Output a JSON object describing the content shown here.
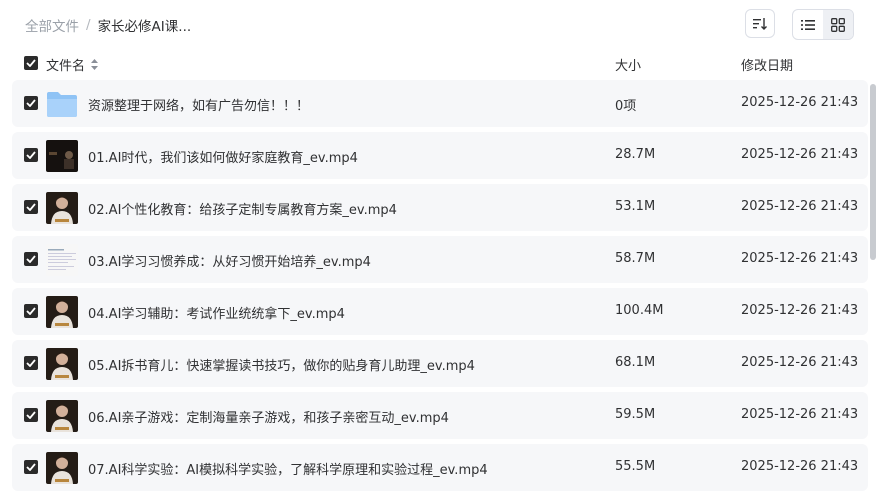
{
  "breadcrumb": {
    "root": "全部文件",
    "separator": "/",
    "current": "家长必修AI课..."
  },
  "toolbar": {
    "sort_icon": "sort-lines-icon",
    "list_icon": "list-view-icon",
    "grid_icon": "grid-view-icon"
  },
  "columns": {
    "name": "文件名",
    "size": "大小",
    "date": "修改日期"
  },
  "files": [
    {
      "name": "资源整理于网络，如有广告勿信！！！",
      "size": "0项",
      "date": "2025-12-26 21:43",
      "kind": "folder"
    },
    {
      "name": "01.AI时代，我们该如何做好家庭教育_ev.mp4",
      "size": "28.7M",
      "date": "2025-12-26 21:43",
      "kind": "video-dark"
    },
    {
      "name": "02.AI个性化教育：给孩子定制专属教育方案_ev.mp4",
      "size": "53.1M",
      "date": "2025-12-26 21:43",
      "kind": "video-person"
    },
    {
      "name": "03.AI学习习惯养成：从好习惯开始培养_ev.mp4",
      "size": "58.7M",
      "date": "2025-12-26 21:43",
      "kind": "video-doc"
    },
    {
      "name": "04.AI学习辅助：考试作业统统拿下_ev.mp4",
      "size": "100.4M",
      "date": "2025-12-26 21:43",
      "kind": "video-person"
    },
    {
      "name": "05.AI拆书育儿：快速掌握读书技巧，做你的贴身育儿助理_ev.mp4",
      "size": "68.1M",
      "date": "2025-12-26 21:43",
      "kind": "video-person"
    },
    {
      "name": "06.AI亲子游戏：定制海量亲子游戏，和孩子亲密互动_ev.mp4",
      "size": "59.5M",
      "date": "2025-12-26 21:43",
      "kind": "video-person"
    },
    {
      "name": "07.AI科学实验：AI模拟科学实验，了解科学原理和实验过程_ev.mp4",
      "size": "55.5M",
      "date": "2025-12-26 21:43",
      "kind": "video-person"
    }
  ]
}
